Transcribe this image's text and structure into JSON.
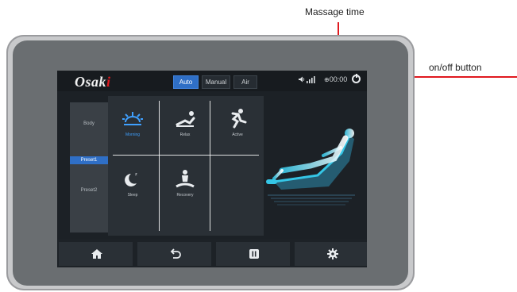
{
  "annotations": {
    "massage_time_label": "Massage time",
    "power_label": "on/off button",
    "color": "#e0191f"
  },
  "app": {
    "logo": {
      "main": "Osak",
      "accent": "i"
    }
  },
  "header": {
    "modes": [
      {
        "label": "Auto",
        "active": true
      },
      {
        "label": "Manual",
        "active": false
      },
      {
        "label": "Air",
        "active": false
      }
    ],
    "volume_icon": "speaker-icon",
    "signal_icon": "signal-bars-icon",
    "timer": "00:00",
    "power_icon": "power-icon"
  },
  "sidebar": {
    "items": [
      {
        "label": "Body",
        "active": false
      },
      {
        "label": "Preset1",
        "active": true
      },
      {
        "label": "Preset2",
        "active": false
      }
    ]
  },
  "programs": [
    {
      "label": "Morning",
      "icon": "sunrise-icon",
      "active": true
    },
    {
      "label": "Relax",
      "icon": "relax-icon",
      "active": false
    },
    {
      "label": "Active",
      "icon": "runner-icon",
      "active": false
    },
    {
      "label": "Sleep",
      "icon": "moon-icon",
      "active": false
    },
    {
      "label": "Recovery",
      "icon": "meditation-icon",
      "active": false
    }
  ],
  "bottombar": {
    "buttons": [
      {
        "name": "home",
        "icon": "home-icon"
      },
      {
        "name": "back",
        "icon": "back-arrow-icon"
      },
      {
        "name": "pause",
        "icon": "pause-icon"
      },
      {
        "name": "settings",
        "icon": "gear-icon"
      }
    ]
  },
  "colors": {
    "accent": "#2f6fc6",
    "active_text": "#3fa0ff",
    "chair_glow": "#35c6e6"
  }
}
